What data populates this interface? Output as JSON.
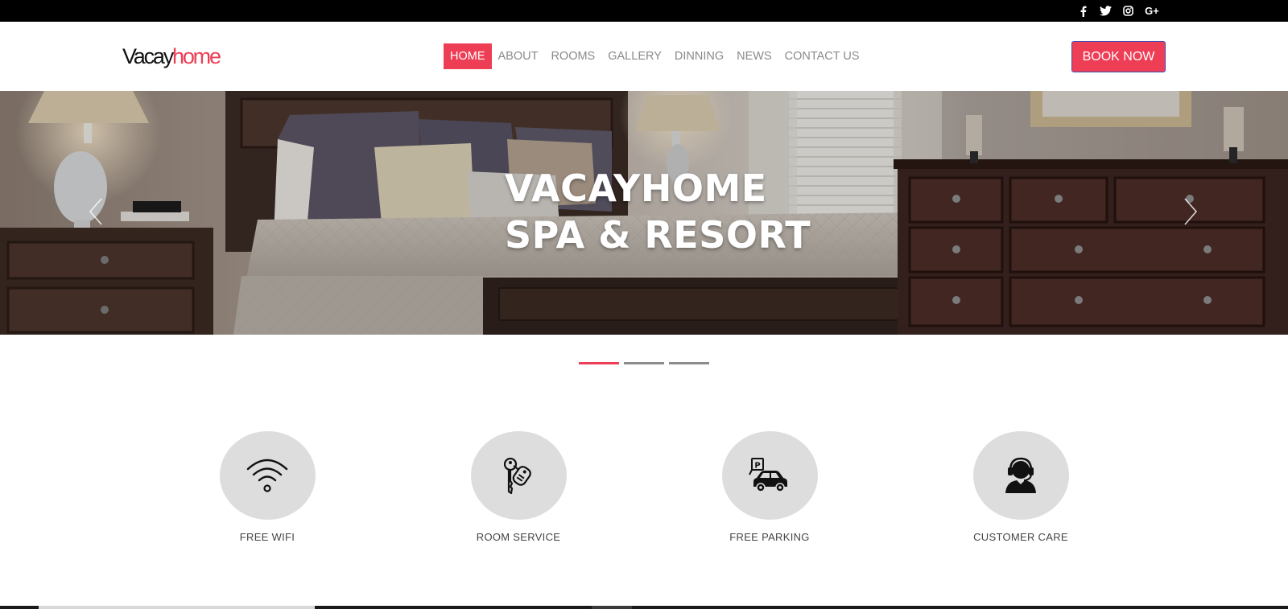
{
  "social": {
    "icons": [
      "facebook-icon",
      "twitter-icon",
      "instagram-icon",
      "google-plus-icon"
    ],
    "google_plus_text": "G+"
  },
  "header": {
    "logo_part1": "Vacay",
    "logo_part2": "home",
    "nav": [
      {
        "label": "HOME",
        "active": true
      },
      {
        "label": "ABOUT"
      },
      {
        "label": "ROOMS"
      },
      {
        "label": "GALLERY"
      },
      {
        "label": "DINNING"
      },
      {
        "label": "NEWS"
      },
      {
        "label": "CONTACT US"
      }
    ],
    "book_button": "BOOK NOW"
  },
  "hero": {
    "line1": "VACAYHOME",
    "line2": "SPA & RESORT",
    "slides": 3,
    "active_slide": 1
  },
  "features": [
    {
      "label": "FREE WIFI",
      "icon": "wifi-icon"
    },
    {
      "label": "ROOM SERVICE",
      "icon": "keys-icon"
    },
    {
      "label": "FREE PARKING",
      "icon": "parking-car-icon"
    },
    {
      "label": "CUSTOMER CARE",
      "icon": "headset-agent-icon"
    }
  ],
  "colors": {
    "accent": "#ee3e56",
    "topbar": "#000000",
    "nav_text": "#8a8a8a",
    "feature_circle": "#dddddd"
  }
}
